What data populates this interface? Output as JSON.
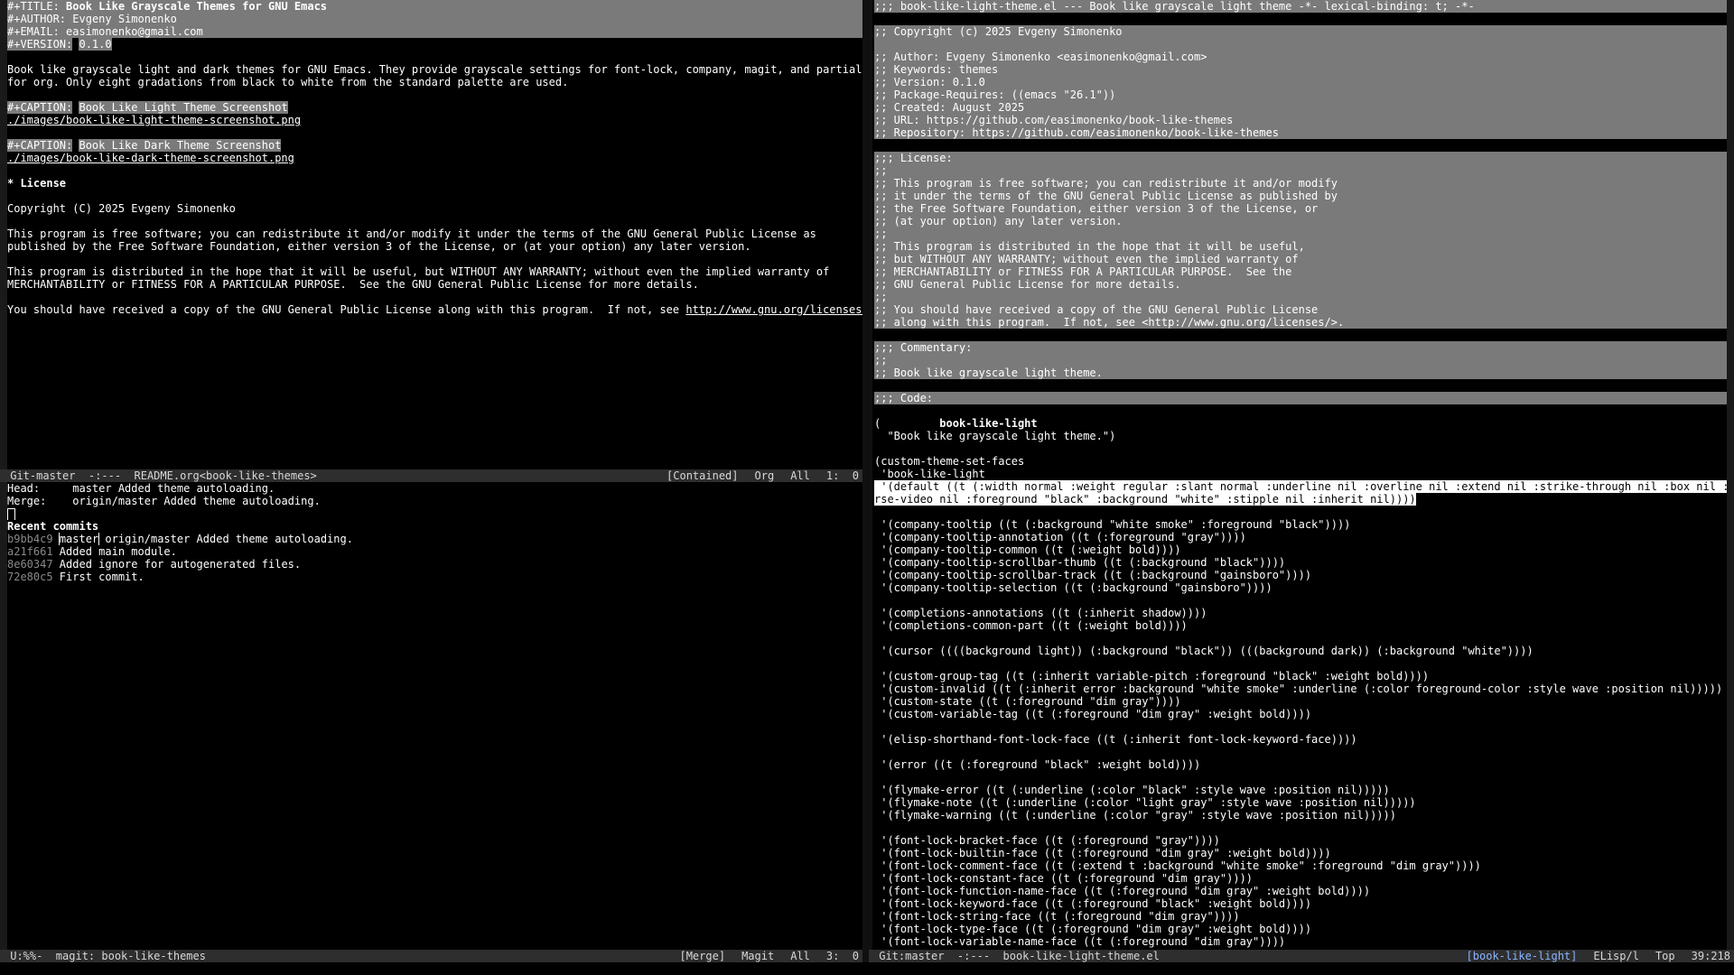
{
  "readme": {
    "title_key": "#+TITLE:",
    "title": "Book Like Grayscale Themes for GNU Emacs",
    "author_key": "#+AUTHOR:",
    "author": "Evgeny Simonenko",
    "email_key": "#+EMAIL:",
    "email": "easimonenko@gmail.com",
    "version_key": "#+VERSION:",
    "version": "0.1.0",
    "intro1": "Book like grayscale light and dark themes for GNU Emacs. They provide grayscale settings for font-lock, company, magit, and partially",
    "intro2": "for org. Only eight gradations from black to white from the standard palette are used.",
    "caption_key": "#+CAPTION:",
    "caption_light": "Book Like Light Theme Screenshot",
    "link_light": "./images/book-like-light-theme-screenshot.png",
    "caption_dark": "Book Like Dark Theme Screenshot",
    "link_dark": "./images/book-like-dark-theme-screenshot.png",
    "license_heading": "* License",
    "copyright": "Copyright (C) 2025 Evgeny Simonenko",
    "p1a": "This program is free software; you can redistribute it and/or modify it under the terms of the GNU General Public License as",
    "p1b": "published by the Free Software Foundation, either version 3 of the License, or (at your option) any later version.",
    "p2a": "This program is distributed in the hope that it will be useful, but WITHOUT ANY WARRANTY; without even the implied warranty of",
    "p2b": "MERCHANTABILITY or FITNESS FOR A PARTICULAR PURPOSE.  See the GNU General Public License for more details.",
    "p3a": "You should have received a copy of the GNU General Public License along with this program.  If not, see ",
    "p3link": "http://www.gnu.org/licenses/",
    "p3end": "."
  },
  "modeline_readme": {
    "left": " Git-master  -:---  README.org<book-like-themes>",
    "r1": "[Contained]",
    "r2": "Org",
    "r3": "All",
    "r4": "1:  0"
  },
  "magit": {
    "head_label": "Head:",
    "head_value": "master Added theme autoloading.",
    "merge_label": "Merge:",
    "merge_value": "origin/master Added theme autoloading.",
    "recent_heading": "Recent commits",
    "commits": [
      {
        "hash": "b9bb4c9",
        "refs": "master",
        "refs2": " origin/master",
        "msg": " Added theme autoloading."
      },
      {
        "hash": "a21f661",
        "refs": "",
        "refs2": "",
        "msg": " Added main module."
      },
      {
        "hash": "8e60347",
        "refs": "",
        "refs2": "",
        "msg": " Added ignore for autogenerated files."
      },
      {
        "hash": "72e80c5",
        "refs": "",
        "refs2": "",
        "msg": " First commit."
      }
    ]
  },
  "modeline_magit": {
    "left": " U:%%-  magit: book-like-themes",
    "r1": "[Merge]",
    "r2": "Magit",
    "r3": "All",
    "r4": "3:  0"
  },
  "elisp": {
    "header": ";;; book-like-light-theme.el --- Book like grayscale light theme -*- lexical-binding: t; -*-",
    "copyright": ";; Copyright (c) 2025 Evgeny Simonenko",
    "meta": [
      ";; Author: Evgeny Simonenko <easimonenko@gmail.com>",
      ";; Keywords: themes",
      ";; Version: 0.1.0",
      ";; Package-Requires: ((emacs \"26.1\"))",
      ";; Created: August 2025",
      ";; URL: https://github.com/easimonenko/book-like-themes",
      ";; Repository: https://github.com/easimonenko/book-like-themes"
    ],
    "license": [
      ";;; License:",
      ";;",
      ";; This program is free software; you can redistribute it and/or modify",
      ";; it under the terms of the GNU General Public License as published by",
      ";; the Free Software Foundation, either version 3 of the License, or",
      ";; (at your option) any later version.",
      ";;",
      ";; This program is distributed in the hope that it will be useful,",
      ";; but WITHOUT ANY WARRANTY; without even the implied warranty of",
      ";; MERCHANTABILITY or FITNESS FOR A PARTICULAR PURPOSE.  See the",
      ";; GNU General Public License for more details.",
      ";;",
      ";; You should have received a copy of the GNU General Public License",
      ";; along with this program.  If not, see <http://www.gnu.org/licenses/>."
    ],
    "commentary": [
      ";;; Commentary:",
      ";;",
      ";; Book like grayscale light theme."
    ],
    "code_heading": ";;; Code:",
    "deftheme_open": "(",
    "deftheme_name": "book-like-light",
    "deftheme_doc": "  \"Book like grayscale light theme.\")",
    "csf": "(custom-theme-set-faces",
    "csf_name": " 'book-like-light",
    "default1": " '(default ((t (:width normal :weight regular :slant normal :underline nil :overline nil :extend nil :strike-through nil :box nil :inve",
    "default2": "rse-video nil :foreground \"black\" :background \"white\" :stipple nil :inherit nil))))",
    "company": [
      " '(company-tooltip ((t (:background \"white smoke\" :foreground \"black\"))))",
      " '(company-tooltip-annotation ((t (:foreground \"gray\"))))",
      " '(company-tooltip-common ((t (:weight bold))))",
      " '(company-tooltip-scrollbar-thumb ((t (:background \"black\"))))",
      " '(company-tooltip-scrollbar-track ((t (:background \"gainsboro\"))))",
      " '(company-tooltip-selection ((t (:background \"gainsboro\"))))"
    ],
    "completions": [
      " '(completions-annotations ((t (:inherit shadow))))",
      " '(completions-common-part ((t (:weight bold))))"
    ],
    "cursor": " '(cursor ((((background light)) (:background \"black\")) (((background dark)) (:background \"white\"))))",
    "custom": [
      " '(custom-group-tag ((t (:inherit variable-pitch :foreground \"black\" :weight bold))))",
      " '(custom-invalid ((t (:inherit error :background \"white smoke\" :underline (:color foreground-color :style wave :position nil)))))",
      " '(custom-state ((t (:foreground \"dim gray\"))))",
      " '(custom-variable-tag ((t (:foreground \"dim gray\" :weight bold))))"
    ],
    "elisp_shorthand": " '(elisp-shorthand-font-lock-face ((t (:inherit font-lock-keyword-face))))",
    "error": " '(error ((t (:foreground \"black\" :weight bold))))",
    "flymake": [
      " '(flymake-error ((t (:underline (:color \"black\" :style wave :position nil)))))",
      " '(flymake-note ((t (:underline (:color \"light gray\" :style wave :position nil)))))",
      " '(flymake-warning ((t (:underline (:color \"gray\" :style wave :position nil)))))"
    ],
    "fontlock": [
      " '(font-lock-bracket-face ((t (:foreground \"gray\"))))",
      " '(font-lock-builtin-face ((t (:foreground \"dim gray\" :weight bold))))",
      " '(font-lock-comment-face ((t (:extend t :background \"white smoke\" :foreground \"dim gray\"))))",
      " '(font-lock-constant-face ((t (:foreground \"dim gray\"))))",
      " '(font-lock-function-name-face ((t (:foreground \"dim gray\" :weight bold))))",
      " '(font-lock-keyword-face ((t (:foreground \"black\" :weight bold))))",
      " '(font-lock-string-face ((t (:foreground \"dim gray\"))))",
      " '(font-lock-type-face ((t (:foreground \"dim gray\" :weight bold))))",
      " '(font-lock-variable-name-face ((t (:foreground \"dim gray\"))))"
    ]
  },
  "modeline_el": {
    "left": " Git:master  -:---  book-like-light-theme.el",
    "r1": "[book-like-light]",
    "r2": "ELisp/l",
    "r3": "Top",
    "r4": "39:218"
  },
  "colors": {
    "background": "#000000",
    "comment_band": "#7a7a7a",
    "keyword_band": "#5a5a5a",
    "modeline": "#2e2e2e"
  }
}
